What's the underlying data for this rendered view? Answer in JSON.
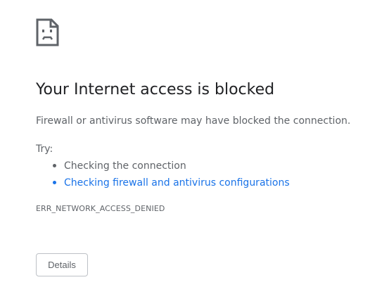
{
  "icon": "sad-page-icon",
  "heading": "Your Internet access is blocked",
  "message": "Firewall or antivirus software may have blocked the connection.",
  "try_label": "Try:",
  "suggestions": [
    {
      "text": "Checking the connection",
      "is_link": false
    },
    {
      "text": "Checking firewall and antivirus configurations",
      "is_link": true
    }
  ],
  "error_code": "ERR_NETWORK_ACCESS_DENIED",
  "details_button": "Details",
  "colors": {
    "heading": "#202124",
    "text": "#5f6368",
    "link": "#1a73e8",
    "button_border": "#bdc1c6"
  }
}
